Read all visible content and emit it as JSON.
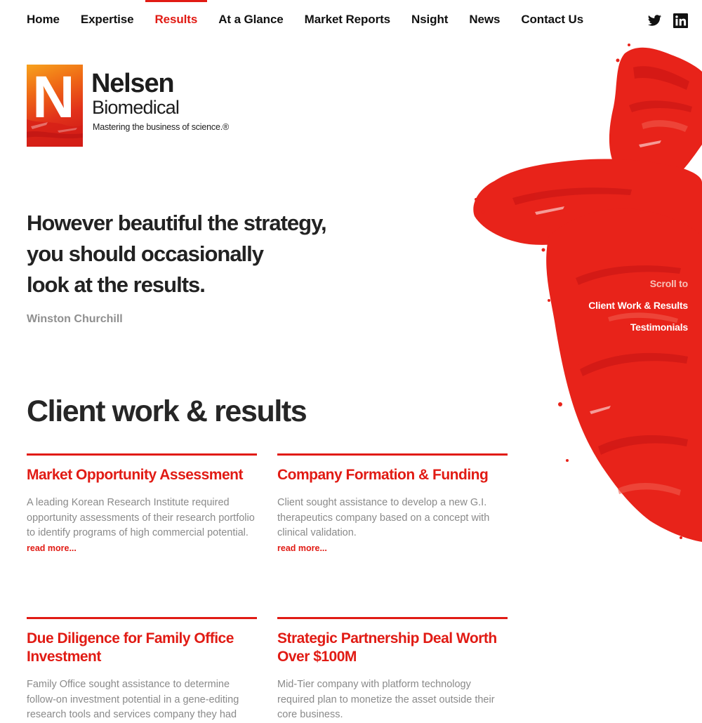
{
  "nav": {
    "items": [
      {
        "label": "Home",
        "active": false
      },
      {
        "label": "Expertise",
        "active": false
      },
      {
        "label": "Results",
        "active": true
      },
      {
        "label": "At a Glance",
        "active": false
      },
      {
        "label": "Market Reports",
        "active": false
      },
      {
        "label": "Nsight",
        "active": false
      },
      {
        "label": "News",
        "active": false
      },
      {
        "label": "Contact Us",
        "active": false
      }
    ],
    "social": [
      {
        "name": "twitter-icon"
      },
      {
        "name": "linkedin-icon"
      }
    ]
  },
  "logo": {
    "letter": "N",
    "name": "Nelsen",
    "subname": "Biomedical",
    "tagline": "Mastering the business of science.®"
  },
  "quote": {
    "lines": [
      "However beautiful the strategy,",
      "you should occasionally",
      "look at the results."
    ],
    "author": "Winston Churchill"
  },
  "scroll_nav": {
    "label": "Scroll to",
    "links": [
      "Client Work & Results",
      "Testimonials"
    ]
  },
  "section": {
    "title": "Client work & results"
  },
  "cards": [
    {
      "title": "Market Opportunity Assessment",
      "text": "A leading Korean Research Institute required opportunity assessments of their research portfolio to identify programs of high commercial potential.",
      "link": "read more..."
    },
    {
      "title": "Company Formation & Funding",
      "text": "Client sought assistance to develop a new G.I. therapeutics company based on a concept with clinical validation.",
      "link": "read more..."
    },
    {
      "title": "Due Diligence for Family Office Investment",
      "text": "Family Office sought assistance to determine follow-on investment potential in a gene-editing research tools and services company they had",
      "link": ""
    },
    {
      "title": "Strategic Partnership Deal Worth Over $100M",
      "text": "Mid-Tier company with platform technology required plan to monetize the asset outside their core business.",
      "link": ""
    }
  ],
  "colors": {
    "accent": "#e11b14",
    "text_dark": "#222222",
    "text_muted": "#8a8a8a"
  }
}
